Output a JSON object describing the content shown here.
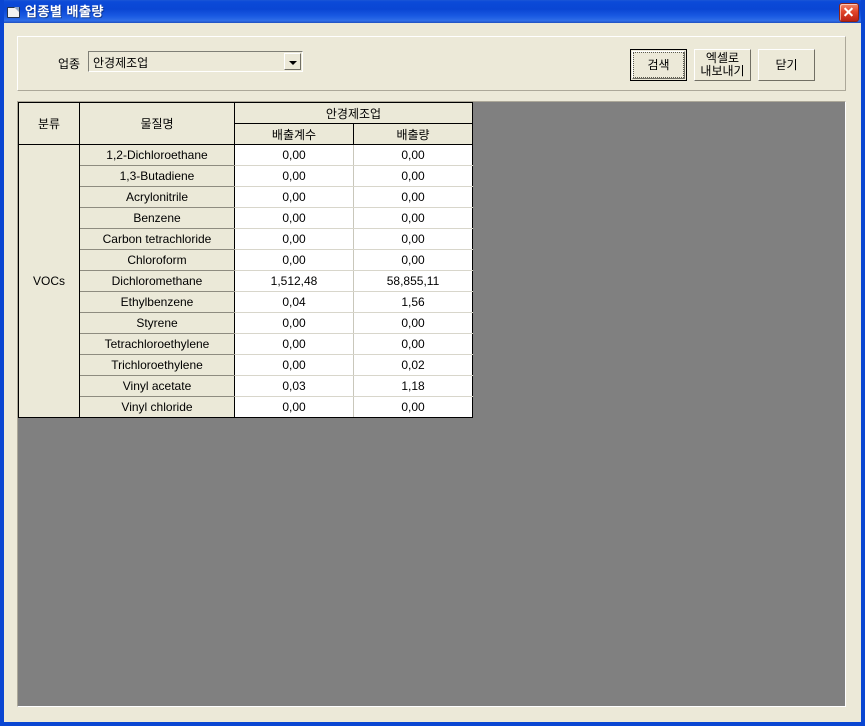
{
  "window": {
    "title": "업종별 배출량",
    "icon": "window-document-icon",
    "close_label": "×",
    "border_color": "#0a46d2",
    "face_color": "#ece9d8"
  },
  "search_panel": {
    "filter_label": "업종",
    "industry_combo": {
      "value": "안경제조업",
      "arrow_icon": "chevron-down-icon"
    },
    "buttons": {
      "search": "검색",
      "export_excel": "엑셀로\n내보내기",
      "close": "닫기"
    }
  },
  "grid": {
    "background_color": "#808080",
    "header": {
      "category": "분류",
      "substance": "물질명",
      "group": "안경제조업",
      "sub_columns": [
        "배출계수",
        "배출량"
      ]
    },
    "category_label": "VOCs",
    "rows": [
      {
        "substance": "1,2-Dichloroethane",
        "factor": "0,00",
        "amount": "0,00"
      },
      {
        "substance": "1,3-Butadiene",
        "factor": "0,00",
        "amount": "0,00"
      },
      {
        "substance": "Acrylonitrile",
        "factor": "0,00",
        "amount": "0,00"
      },
      {
        "substance": "Benzene",
        "factor": "0,00",
        "amount": "0,00"
      },
      {
        "substance": "Carbon tetrachloride",
        "factor": "0,00",
        "amount": "0,00"
      },
      {
        "substance": "Chloroform",
        "factor": "0,00",
        "amount": "0,00"
      },
      {
        "substance": "Dichloromethane",
        "factor": "1,512,48",
        "amount": "58,855,11"
      },
      {
        "substance": "Ethylbenzene",
        "factor": "0,04",
        "amount": "1,56"
      },
      {
        "substance": "Styrene",
        "factor": "0,00",
        "amount": "0,00"
      },
      {
        "substance": "Tetrachloroethylene",
        "factor": "0,00",
        "amount": "0,00"
      },
      {
        "substance": "Trichloroethylene",
        "factor": "0,00",
        "amount": "0,02"
      },
      {
        "substance": "Vinyl acetate",
        "factor": "0,03",
        "amount": "1,18"
      },
      {
        "substance": "Vinyl chloride",
        "factor": "0,00",
        "amount": "0,00"
      }
    ]
  }
}
